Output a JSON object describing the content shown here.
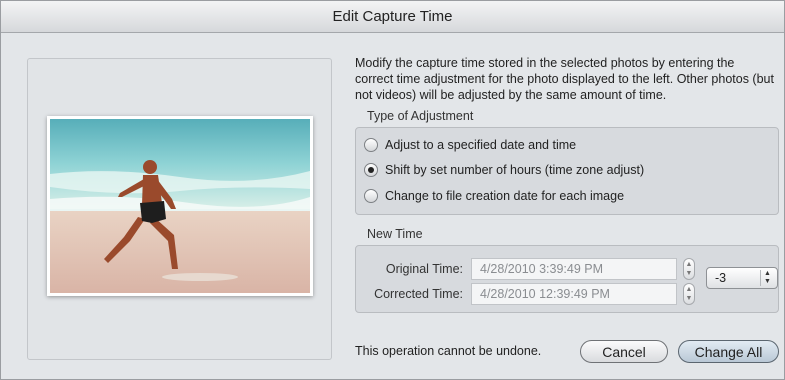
{
  "window": {
    "title": "Edit Capture Time"
  },
  "description": "Modify the capture time stored in the selected photos by entering the correct time adjustment for the photo displayed to the left. Other photos (but not videos) will be adjusted by the same amount of time.",
  "adjustment": {
    "label": "Type of Adjustment",
    "options": [
      {
        "label": "Adjust to a specified date and time",
        "selected": false
      },
      {
        "label": "Shift by set number of hours (time zone adjust)",
        "selected": true
      },
      {
        "label": "Change to file creation date for each image",
        "selected": false
      }
    ]
  },
  "new_time": {
    "label": "New Time",
    "original_label": "Original Time:",
    "original_value": "4/28/2010   3:39:49 PM",
    "corrected_label": "Corrected Time:",
    "corrected_value": "4/28/2010 12:39:49 PM",
    "hour_offset": "-3"
  },
  "footer": {
    "note": "This operation cannot be undone.",
    "cancel_label": "Cancel",
    "change_all_label": "Change All"
  },
  "icons": {
    "stepper": "stepper-arrows-icon",
    "select": "popup-arrows-icon"
  }
}
